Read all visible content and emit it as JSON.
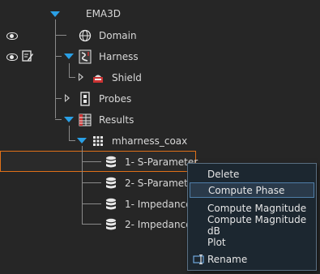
{
  "tree": {
    "root": "EMA3D",
    "domain": "Domain",
    "harness": "Harness",
    "shield": "Shield",
    "probes": "Probes",
    "results": "Results",
    "mharness": "mharness_coax",
    "items": [
      {
        "label": "1- S-Parameter"
      },
      {
        "label": "2- S-Paramete"
      },
      {
        "label": "1- Impedance"
      },
      {
        "label": "2- Impedance"
      }
    ]
  },
  "context_menu": {
    "delete": "Delete",
    "compute_phase": "Compute Phase",
    "compute_magnitude": "Compute Magnitude",
    "compute_magnitude_db": "Compute Magnitude dB",
    "plot": "Plot",
    "rename": "Rename"
  },
  "colors": {
    "accent_blue": "#2aa0e6",
    "selection_orange": "#e07018",
    "menu_highlight_border": "#4f7ea8"
  },
  "icons": {
    "domain": "globe-icon",
    "harness": "harness-icon",
    "shield": "shield-icon",
    "probes": "probe-icon",
    "results": "results-table-icon",
    "mharness": "grid-icon",
    "result_item": "database-icon",
    "visibility": "eye-icon",
    "edit": "edit-icon",
    "rename": "rename-icon"
  }
}
